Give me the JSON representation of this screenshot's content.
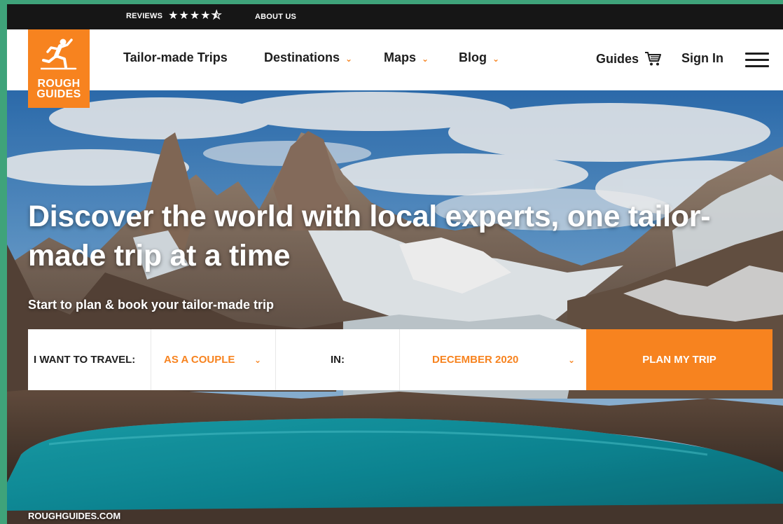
{
  "topbar": {
    "reviews_label": "REVIEWS",
    "stars": "★★★★⯪",
    "rating": 4.5,
    "about_label": "ABOUT US"
  },
  "logo": {
    "line1": "ROUGH",
    "line2": "GUIDES"
  },
  "nav": {
    "tailor_made": "Tailor-made Trips",
    "destinations": "Destinations",
    "maps": "Maps",
    "blog": "Blog",
    "guides": "Guides",
    "sign_in": "Sign In"
  },
  "hero": {
    "headline": "Discover the world with local experts, one tailor-made trip at a time",
    "subline": "Start to plan & book your tailor-made trip"
  },
  "planner": {
    "travel_label": "I WANT TO TRAVEL:",
    "companion_value": "AS A COUPLE",
    "in_label": "IN:",
    "date_value": "DECEMBER 2020",
    "button_label": "PLAN MY TRIP"
  },
  "footer": {
    "site": "ROUGHGUIDES.COM"
  },
  "colors": {
    "brand_orange": "#f7831f",
    "topbar_bg": "#161616",
    "frame_green": "#3fa37a"
  },
  "icons": {
    "cart": "cart-icon",
    "menu": "hamburger-menu-icon",
    "chevron": "chevron-down-icon",
    "logo_runner": "runner-icon"
  }
}
